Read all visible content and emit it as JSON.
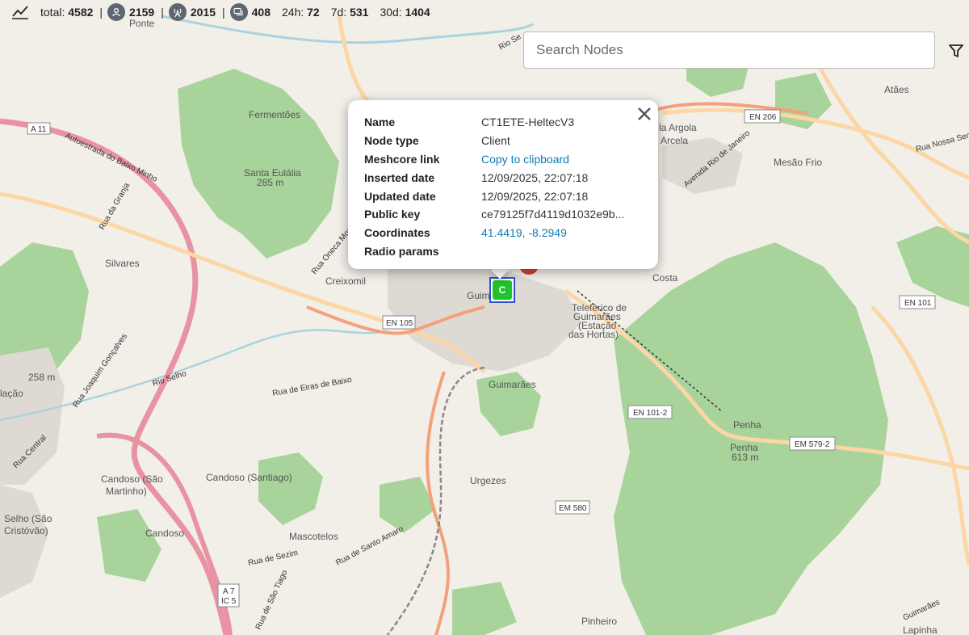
{
  "stats": {
    "total_label": "total:",
    "total": "4582",
    "clients": "2159",
    "repeaters": "2015",
    "rooms": "408",
    "d24_label": "24h:",
    "d24": "72",
    "d7_label": "7d:",
    "d7": "531",
    "d30_label": "30d:",
    "d30": "1404",
    "separator": "|"
  },
  "search": {
    "placeholder": "Search Nodes"
  },
  "popup": {
    "rows": [
      {
        "key": "Name",
        "value": "CT1ETE-HeltecV3"
      },
      {
        "key": "Node type",
        "value": "Client"
      },
      {
        "key": "Meshcore link",
        "value": "Copy to clipboard"
      },
      {
        "key": "Inserted date",
        "value": "12/09/2025, 22:07:18"
      },
      {
        "key": "Updated date",
        "value": "12/09/2025, 22:07:18"
      },
      {
        "key": "Public key",
        "value": "ce79125f7d4119d1032e9b..."
      },
      {
        "key": "Coordinates",
        "value": "41.4419, -8.2949"
      },
      {
        "key": "Radio params",
        "value": ""
      }
    ]
  },
  "marker": {
    "letter": "C",
    "color": "#22c22e",
    "border_color": "#2a57c8"
  },
  "map": {
    "places": {
      "fermentoes": "Fermentões",
      "santa_eulalia": "Santa Eulália",
      "santa_eulalia_elev": "285 m",
      "silvares": "Silvares",
      "creixomil": "Creixomil",
      "guimaraes": "Guimarães",
      "costa": "Costa",
      "mesao_frio": "Mesão Frio",
      "ataes": "Atães",
      "penha": "Penha",
      "penha2": "Penha",
      "penha_elev": "613 m",
      "candoso_sm": "Candoso (São",
      "candoso_sm2": "Martinho)",
      "candoso_santiago": "Candoso (Santiago)",
      "urgezes": "Urgezes",
      "mascotelos": "Mascotelos",
      "selho": "Selho (São",
      "selho2": "Cristóvão)",
      "pinheiro": "Pinheiro",
      "candoso": "Candoso",
      "ponte": "Ponte",
      "elev_258": "258 m",
      "placao": "lação",
      "guimaraes_station": "Guimarães",
      "teleferico1": "Teleférico de",
      "teleferico2": "Guimarães",
      "teleferico3": "(Estação",
      "teleferico4": "das Hortas)",
      "argola": "la Argola",
      "arcela": "Arcela",
      "lapinha": "Lapinha"
    },
    "roads": {
      "a11": "A 11",
      "en206": "EN 206",
      "en101": "EN 101",
      "en105": "EN 105",
      "en101_2": "EN 101-2",
      "em579_2": "EM 579-2",
      "em580": "EM 580",
      "a7": "A 7",
      "ic5": "IC 5",
      "autoestrada": "Autoestrada do Baixo Minho",
      "rio_selho": "Rio Selho",
      "rua_eiras": "Rua de Eiras de Baixo",
      "rua_joaquim": "Rua Joaquim Gonçalves",
      "rua_sezim": "Rua de Sezim",
      "rua_santo_amaro": "Rua de Santo Amaro",
      "rua_sao_tiago": "Rua de São Tiago",
      "rua_central": "Rua Central",
      "rua_granja": "Rua da Granja",
      "rua_oneca": "Rua Oneca Mondim",
      "rua_nossa": "Rua Nossa Senhor",
      "avenida_rio": "Avenida Rio de Janeiro",
      "rio_sn": "Rio Se",
      "guimaraes_road": "Guimarães"
    }
  }
}
